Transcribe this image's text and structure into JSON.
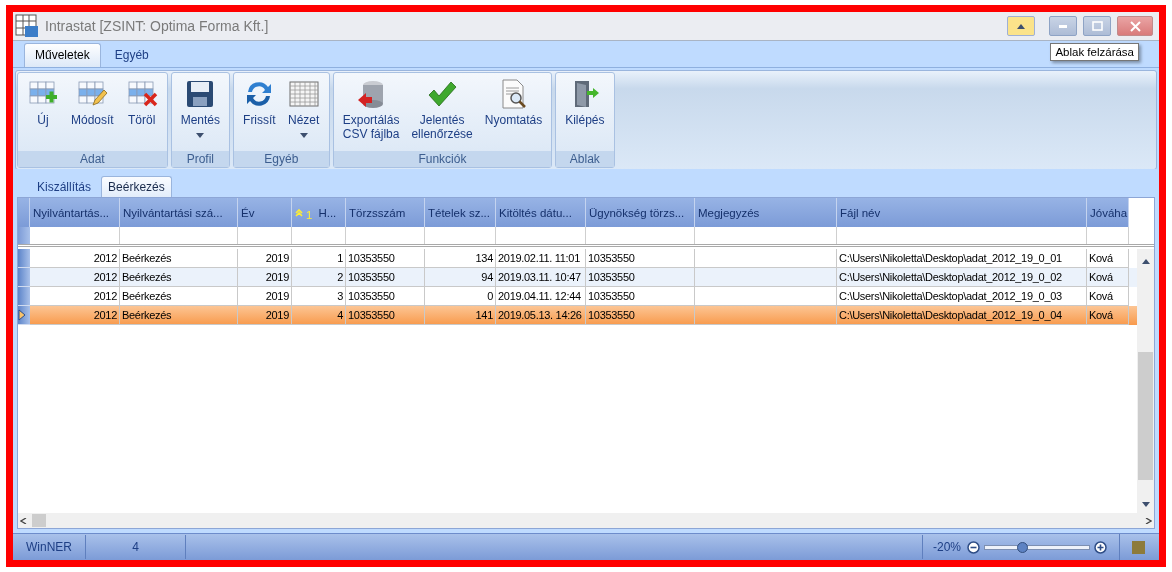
{
  "window": {
    "title": "Intrastat [ZSINT: Optima Forma Kft.]"
  },
  "ribbon_tabs": [
    {
      "label": "Műveletek",
      "selected": true
    },
    {
      "label": "Egyéb",
      "selected": false
    }
  ],
  "ribbon_groups": [
    {
      "label": "Adat",
      "buttons": [
        {
          "label": "Új",
          "dropdown": false
        },
        {
          "label": "Módosít",
          "dropdown": false
        },
        {
          "label": "Töröl",
          "dropdown": false
        }
      ]
    },
    {
      "label": "Profil",
      "buttons": [
        {
          "label": "Mentés",
          "dropdown": true
        }
      ]
    },
    {
      "label": "Egyéb",
      "buttons": [
        {
          "label": "Frissít",
          "dropdown": false
        },
        {
          "label": "Nézet",
          "dropdown": true
        }
      ]
    },
    {
      "label": "Funkciók",
      "buttons": [
        {
          "label": "Exportálás\nCSV fájlba",
          "dropdown": false
        },
        {
          "label": "Jelentés\nellenőrzése",
          "dropdown": false
        },
        {
          "label": "Nyomtatás",
          "dropdown": false
        }
      ]
    },
    {
      "label": "Ablak",
      "buttons": [
        {
          "label": "Kilépés",
          "dropdown": false
        }
      ]
    }
  ],
  "tooltip": "Ablak felzárása",
  "data_tabs": [
    {
      "label": "Kiszállítás",
      "selected": false
    },
    {
      "label": "Beérkezés",
      "selected": true
    }
  ],
  "table": {
    "columns": [
      {
        "label": "Nyilvántartás...",
        "sorted": false
      },
      {
        "label": "Nyilvántartási szá...",
        "sorted": false
      },
      {
        "label": "Év",
        "sorted": false
      },
      {
        "label": "H...",
        "sorted": true,
        "sort_order": "1"
      },
      {
        "label": "Törzsszám",
        "sorted": false
      },
      {
        "label": "Tételek sz...",
        "sorted": false
      },
      {
        "label": "Kitöltés dátu...",
        "sorted": false
      },
      {
        "label": "Ügynökség törzs...",
        "sorted": false
      },
      {
        "label": "Megjegyzés",
        "sorted": false
      },
      {
        "label": "Fájl név",
        "sorted": false
      },
      {
        "label": "Jóváha",
        "sorted": false
      }
    ],
    "rows": [
      {
        "selected": false,
        "cells": [
          "2012",
          "Beérkezés",
          "2019",
          "1",
          "10353550",
          "134",
          "2019.02.11. 11:01",
          "10353550",
          "",
          "C:\\Users\\Nikoletta\\Desktop\\adat_2012_19_0_01",
          "Ková"
        ]
      },
      {
        "selected": false,
        "cells": [
          "2012",
          "Beérkezés",
          "2019",
          "2",
          "10353550",
          "94",
          "2019.03.11. 10:47",
          "10353550",
          "",
          "C:\\Users\\Nikoletta\\Desktop\\adat_2012_19_0_02",
          "Ková"
        ]
      },
      {
        "selected": false,
        "cells": [
          "2012",
          "Beérkezés",
          "2019",
          "3",
          "10353550",
          "0",
          "2019.04.11. 12:44",
          "10353550",
          "",
          "C:\\Users\\Nikoletta\\Desktop\\adat_2012_19_0_03",
          "Ková"
        ]
      },
      {
        "selected": true,
        "cells": [
          "2012",
          "Beérkezés",
          "2019",
          "4",
          "10353550",
          "141",
          "2019.05.13. 14:26",
          "10353550",
          "",
          "C:\\Users\\Nikoletta\\Desktop\\adat_2012_19_0_04",
          "Ková"
        ]
      }
    ]
  },
  "status_bar": {
    "app": "WinNER",
    "count": "4",
    "zoom": "-20%",
    "zoom_slider": {
      "level": 0.36
    }
  }
}
